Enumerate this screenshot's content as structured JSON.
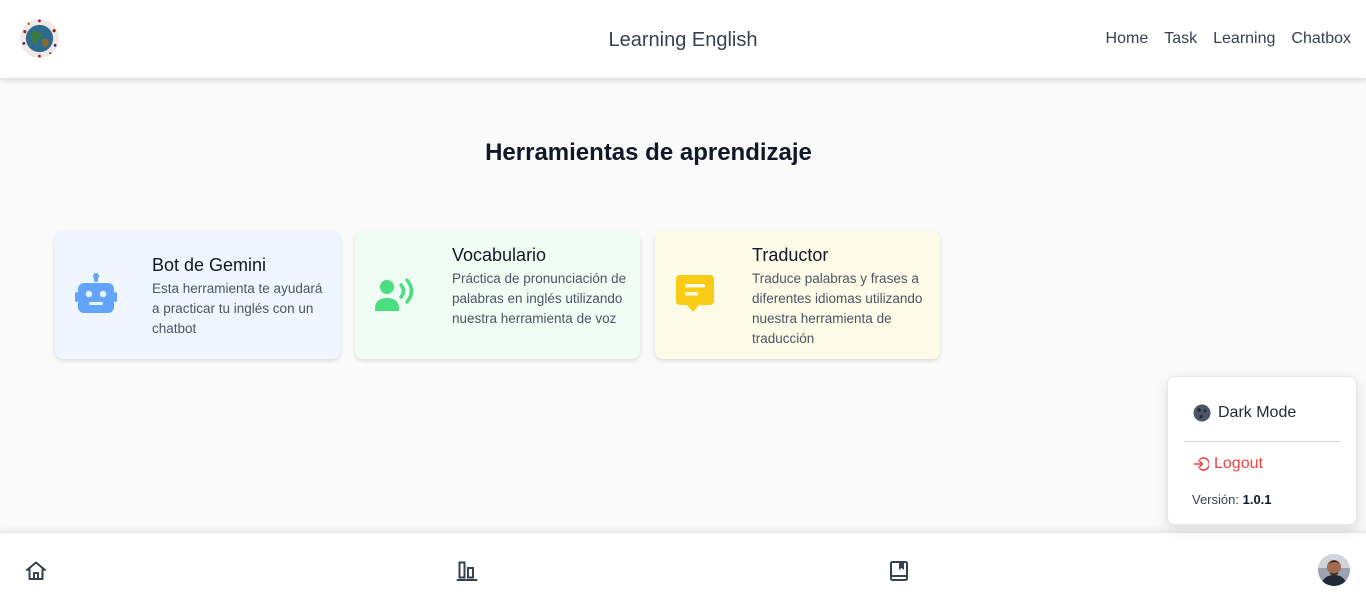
{
  "header": {
    "title": "Learning English",
    "nav": [
      "Home",
      "Task",
      "Learning",
      "Chatbox"
    ]
  },
  "main": {
    "heading": "Herramientas de aprendizaje",
    "cards": [
      {
        "title": "Bot de Gemini",
        "description": "Esta herramienta te ayudará a practicar tu inglés con un chatbot",
        "icon": "robot-icon",
        "color": "#60a5fa"
      },
      {
        "title": "Vocabulario",
        "description": "Práctica de pronunciación de palabras en inglés utilizando nuestra herramienta de voz",
        "icon": "voice-icon",
        "color": "#4ade80"
      },
      {
        "title": "Traductor",
        "description": "Traduce palabras y frases a diferentes idiomas utilizando nuestra herramienta de traducción",
        "icon": "message-icon",
        "color": "#facc15"
      }
    ]
  },
  "settings_menu": {
    "dark_mode_label": "Dark Mode",
    "logout_label": "Logout",
    "version_label": "Versión:",
    "version_value": "1.0.1"
  },
  "bottom_nav": {
    "icons": [
      "home-icon",
      "chart-icon",
      "book-icon"
    ]
  },
  "colors": {
    "accent_red": "#ef4444",
    "card_blue_bg": "#eff6ff",
    "card_green_bg": "#f0fdf4",
    "card_yellow_bg": "#fefce8"
  }
}
